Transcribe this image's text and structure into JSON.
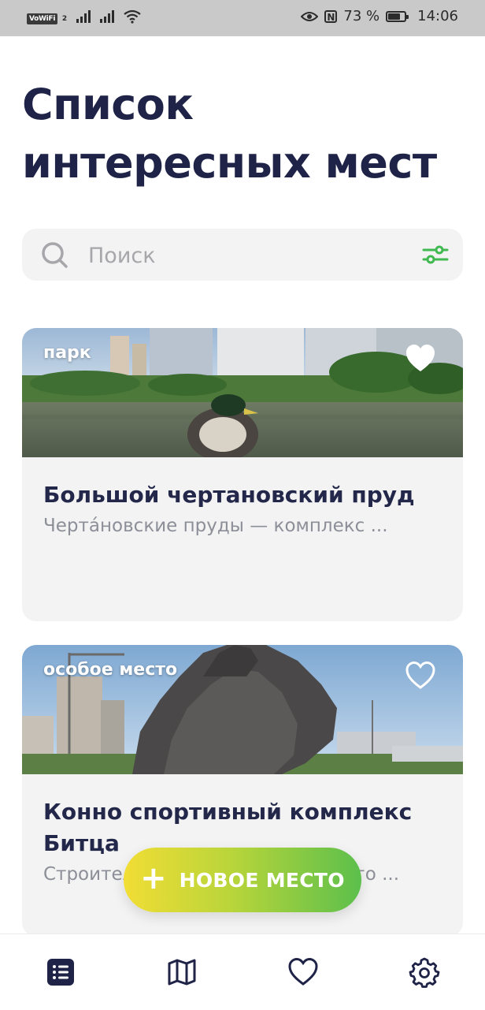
{
  "status_bar": {
    "volte": "VoWiFi",
    "sim": "2",
    "battery_percent": "73 %",
    "battery_level": 0.73,
    "time": "14:06"
  },
  "page": {
    "title": "Список интересных мест"
  },
  "search": {
    "placeholder": "Поиск",
    "value": ""
  },
  "places": [
    {
      "tag": "парк",
      "title": "Большой чертановский пруд",
      "description": "Черта́новские пруды — комплекс ...",
      "favorite": true
    },
    {
      "tag": "особое место",
      "title": "Конно спортивный комплекс Битца",
      "description": "Строительство конно спортивного ...",
      "favorite": false
    }
  ],
  "fab": {
    "label": "НОВОЕ МЕСТО"
  },
  "colors": {
    "title": "#1f2347",
    "accent_green": "#3fb950",
    "fab_gradient_start": "#f2dd35",
    "fab_gradient_end": "#5cbf4c",
    "card_bg": "#f3f3f3"
  },
  "bottom_nav": {
    "items": [
      {
        "icon": "list-icon",
        "active": true
      },
      {
        "icon": "map-icon",
        "active": false
      },
      {
        "icon": "heart-icon",
        "active": false
      },
      {
        "icon": "gear-icon",
        "active": false
      }
    ]
  }
}
